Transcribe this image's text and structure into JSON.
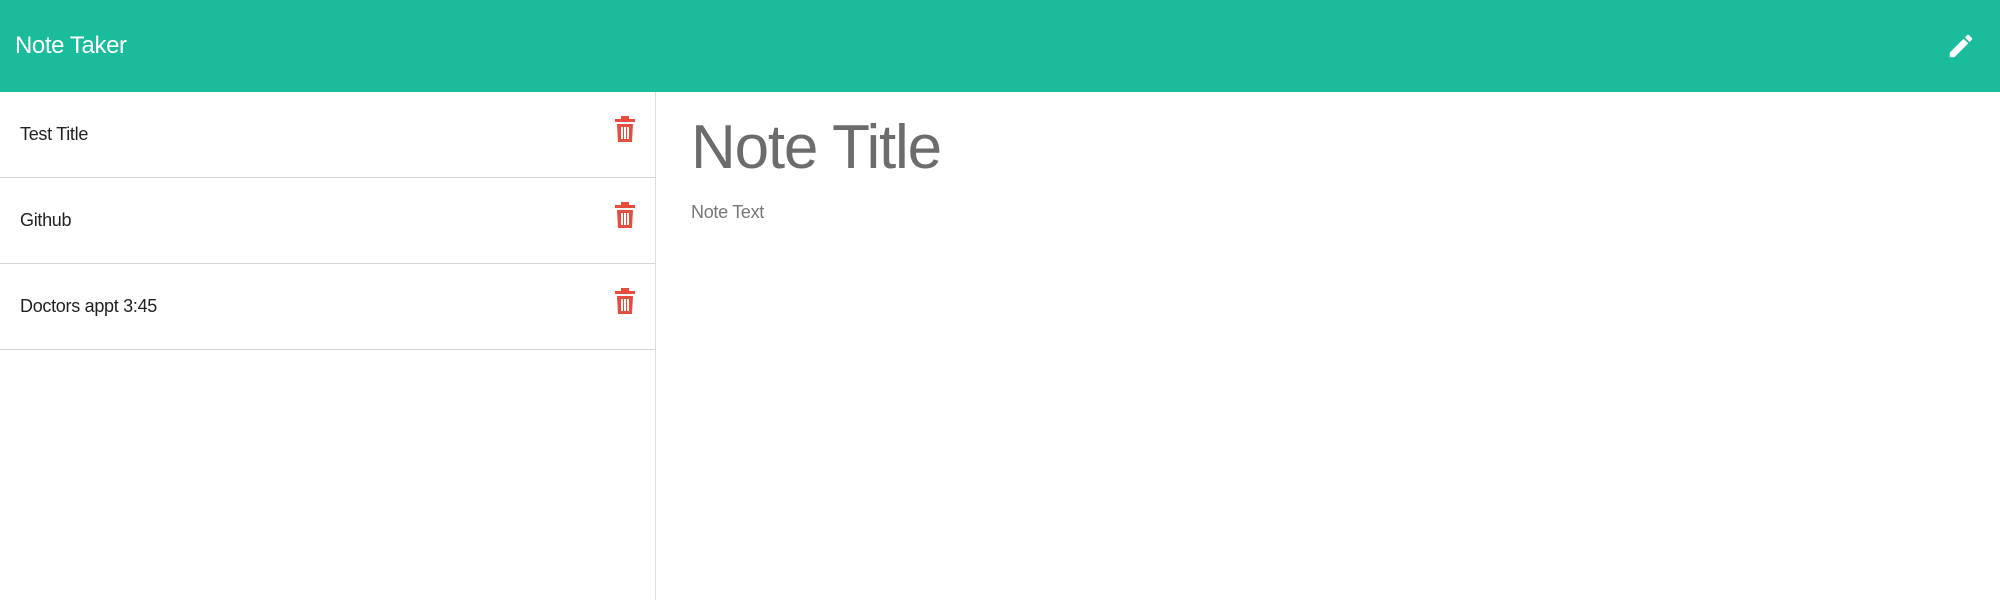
{
  "app": {
    "title": "Note Taker"
  },
  "toolbar": {
    "new_note_icon": "pencil-icon",
    "icon_color": "#ffffff"
  },
  "colors": {
    "navbar": "#1abc9c",
    "delete_icon": "#e74c3c"
  },
  "sidebar": {
    "notes": [
      {
        "title": "Test Title",
        "delete_icon": "trash-icon"
      },
      {
        "title": "Github",
        "delete_icon": "trash-icon"
      },
      {
        "title": "Doctors appt 3:45",
        "delete_icon": "trash-icon"
      }
    ]
  },
  "editor": {
    "title_placeholder": "Note Title",
    "title_value": "",
    "text_placeholder": "Note Text",
    "text_value": ""
  }
}
